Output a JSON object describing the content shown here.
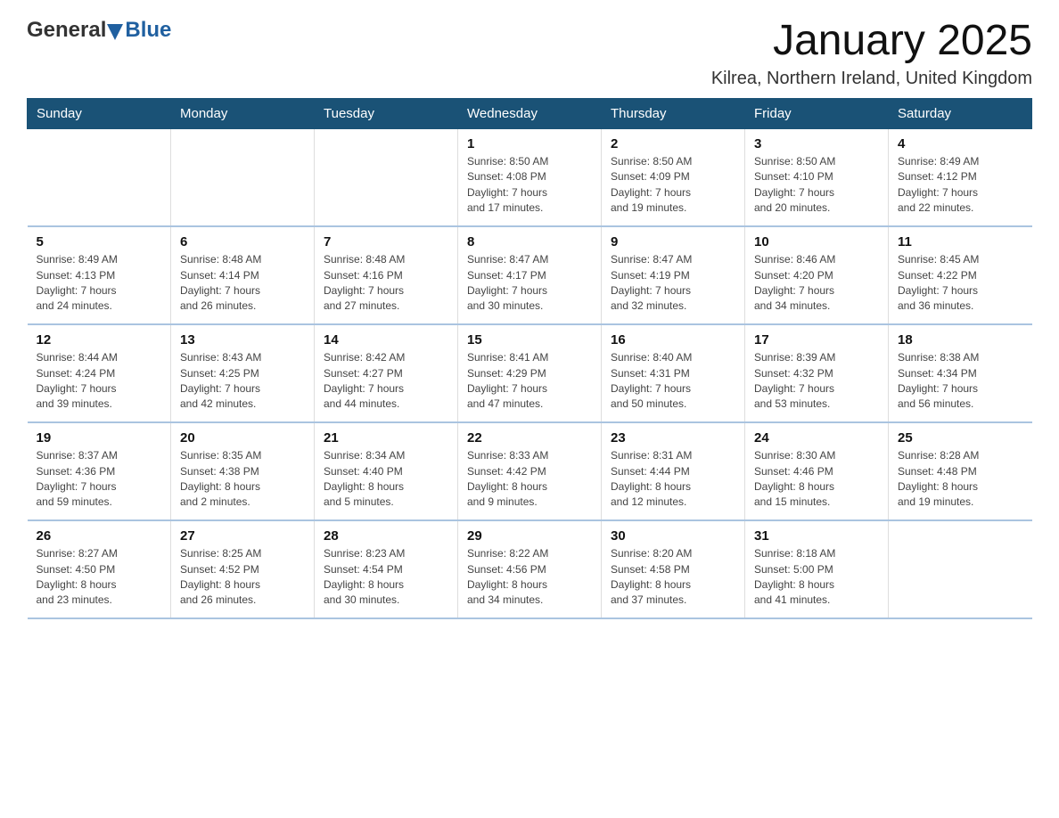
{
  "header": {
    "logo": {
      "general": "General",
      "blue": "Blue"
    },
    "title": "January 2025",
    "subtitle": "Kilrea, Northern Ireland, United Kingdom"
  },
  "calendar": {
    "weekdays": [
      "Sunday",
      "Monday",
      "Tuesday",
      "Wednesday",
      "Thursday",
      "Friday",
      "Saturday"
    ],
    "weeks": [
      [
        {
          "day": "",
          "info": ""
        },
        {
          "day": "",
          "info": ""
        },
        {
          "day": "",
          "info": ""
        },
        {
          "day": "1",
          "info": "Sunrise: 8:50 AM\nSunset: 4:08 PM\nDaylight: 7 hours\nand 17 minutes."
        },
        {
          "day": "2",
          "info": "Sunrise: 8:50 AM\nSunset: 4:09 PM\nDaylight: 7 hours\nand 19 minutes."
        },
        {
          "day": "3",
          "info": "Sunrise: 8:50 AM\nSunset: 4:10 PM\nDaylight: 7 hours\nand 20 minutes."
        },
        {
          "day": "4",
          "info": "Sunrise: 8:49 AM\nSunset: 4:12 PM\nDaylight: 7 hours\nand 22 minutes."
        }
      ],
      [
        {
          "day": "5",
          "info": "Sunrise: 8:49 AM\nSunset: 4:13 PM\nDaylight: 7 hours\nand 24 minutes."
        },
        {
          "day": "6",
          "info": "Sunrise: 8:48 AM\nSunset: 4:14 PM\nDaylight: 7 hours\nand 26 minutes."
        },
        {
          "day": "7",
          "info": "Sunrise: 8:48 AM\nSunset: 4:16 PM\nDaylight: 7 hours\nand 27 minutes."
        },
        {
          "day": "8",
          "info": "Sunrise: 8:47 AM\nSunset: 4:17 PM\nDaylight: 7 hours\nand 30 minutes."
        },
        {
          "day": "9",
          "info": "Sunrise: 8:47 AM\nSunset: 4:19 PM\nDaylight: 7 hours\nand 32 minutes."
        },
        {
          "day": "10",
          "info": "Sunrise: 8:46 AM\nSunset: 4:20 PM\nDaylight: 7 hours\nand 34 minutes."
        },
        {
          "day": "11",
          "info": "Sunrise: 8:45 AM\nSunset: 4:22 PM\nDaylight: 7 hours\nand 36 minutes."
        }
      ],
      [
        {
          "day": "12",
          "info": "Sunrise: 8:44 AM\nSunset: 4:24 PM\nDaylight: 7 hours\nand 39 minutes."
        },
        {
          "day": "13",
          "info": "Sunrise: 8:43 AM\nSunset: 4:25 PM\nDaylight: 7 hours\nand 42 minutes."
        },
        {
          "day": "14",
          "info": "Sunrise: 8:42 AM\nSunset: 4:27 PM\nDaylight: 7 hours\nand 44 minutes."
        },
        {
          "day": "15",
          "info": "Sunrise: 8:41 AM\nSunset: 4:29 PM\nDaylight: 7 hours\nand 47 minutes."
        },
        {
          "day": "16",
          "info": "Sunrise: 8:40 AM\nSunset: 4:31 PM\nDaylight: 7 hours\nand 50 minutes."
        },
        {
          "day": "17",
          "info": "Sunrise: 8:39 AM\nSunset: 4:32 PM\nDaylight: 7 hours\nand 53 minutes."
        },
        {
          "day": "18",
          "info": "Sunrise: 8:38 AM\nSunset: 4:34 PM\nDaylight: 7 hours\nand 56 minutes."
        }
      ],
      [
        {
          "day": "19",
          "info": "Sunrise: 8:37 AM\nSunset: 4:36 PM\nDaylight: 7 hours\nand 59 minutes."
        },
        {
          "day": "20",
          "info": "Sunrise: 8:35 AM\nSunset: 4:38 PM\nDaylight: 8 hours\nand 2 minutes."
        },
        {
          "day": "21",
          "info": "Sunrise: 8:34 AM\nSunset: 4:40 PM\nDaylight: 8 hours\nand 5 minutes."
        },
        {
          "day": "22",
          "info": "Sunrise: 8:33 AM\nSunset: 4:42 PM\nDaylight: 8 hours\nand 9 minutes."
        },
        {
          "day": "23",
          "info": "Sunrise: 8:31 AM\nSunset: 4:44 PM\nDaylight: 8 hours\nand 12 minutes."
        },
        {
          "day": "24",
          "info": "Sunrise: 8:30 AM\nSunset: 4:46 PM\nDaylight: 8 hours\nand 15 minutes."
        },
        {
          "day": "25",
          "info": "Sunrise: 8:28 AM\nSunset: 4:48 PM\nDaylight: 8 hours\nand 19 minutes."
        }
      ],
      [
        {
          "day": "26",
          "info": "Sunrise: 8:27 AM\nSunset: 4:50 PM\nDaylight: 8 hours\nand 23 minutes."
        },
        {
          "day": "27",
          "info": "Sunrise: 8:25 AM\nSunset: 4:52 PM\nDaylight: 8 hours\nand 26 minutes."
        },
        {
          "day": "28",
          "info": "Sunrise: 8:23 AM\nSunset: 4:54 PM\nDaylight: 8 hours\nand 30 minutes."
        },
        {
          "day": "29",
          "info": "Sunrise: 8:22 AM\nSunset: 4:56 PM\nDaylight: 8 hours\nand 34 minutes."
        },
        {
          "day": "30",
          "info": "Sunrise: 8:20 AM\nSunset: 4:58 PM\nDaylight: 8 hours\nand 37 minutes."
        },
        {
          "day": "31",
          "info": "Sunrise: 8:18 AM\nSunset: 5:00 PM\nDaylight: 8 hours\nand 41 minutes."
        },
        {
          "day": "",
          "info": ""
        }
      ]
    ]
  }
}
